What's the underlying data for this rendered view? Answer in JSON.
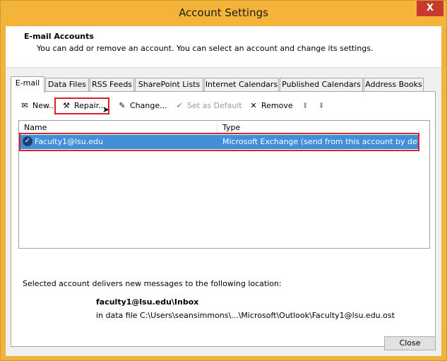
{
  "window": {
    "title": "Account Settings",
    "close_glyph": "X"
  },
  "header": {
    "title": "E-mail Accounts",
    "description": "You can add or remove an account. You can select an account and change its settings."
  },
  "tabs": [
    {
      "label": "E-mail",
      "active": true
    },
    {
      "label": "Data Files"
    },
    {
      "label": "RSS Feeds"
    },
    {
      "label": "SharePoint Lists"
    },
    {
      "label": "Internet Calendars"
    },
    {
      "label": "Published Calendars"
    },
    {
      "label": "Address Books"
    }
  ],
  "toolbar": {
    "new_label": "New...",
    "repair_label": "Repair...",
    "change_label": "Change...",
    "set_default_label": "Set as Default",
    "remove_label": "Remove"
  },
  "accounts": {
    "columns": [
      "Name",
      "Type"
    ],
    "rows": [
      {
        "name": "Faculty1@lsu.edu",
        "type": "Microsoft Exchange (send from this account by def..."
      }
    ]
  },
  "delivery": {
    "text": "Selected account delivers new messages to the following location:",
    "location": "faculty1@lsu.edu\\Inbox",
    "data_file": "in data file C:\\Users\\seansimmons\\...\\Microsoft\\Outlook\\Faculty1@lsu.edu.ost"
  },
  "footer": {
    "close_label": "Close"
  },
  "colors": {
    "title_bar": "#f4b43a",
    "selection": "#3f8fd9",
    "highlight_box": "#d8202e"
  }
}
